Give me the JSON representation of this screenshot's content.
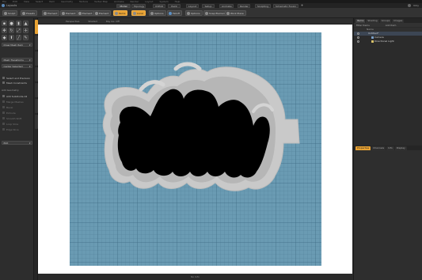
{
  "titlebar": {
    "items": [
      "File",
      "Edit",
      "View",
      "Select",
      "Item",
      "Geometry",
      "Texture",
      "Vertex Map",
      "Animate",
      "Render",
      "Layout",
      "System",
      "Help"
    ]
  },
  "app": {
    "title": "Layouts"
  },
  "layout_tabs": [
    "Model",
    "Topology",
    "UVEdit",
    "Paint",
    "Layout",
    "Setup",
    "Animate",
    "Render",
    "Sculpting",
    "Schematic Fusion"
  ],
  "layout_tabs_active": "Model",
  "tabbar_right": {
    "label": "Only"
  },
  "toolbar": {
    "buttons": [
      {
        "label": "Sculpt",
        "icon": "sculpt-icon"
      },
      {
        "label": "Presets",
        "icon": "presets-icon"
      },
      {
        "label": "Element",
        "icon": "vertex-icon"
      },
      {
        "label": "Element",
        "icon": "edge-icon"
      },
      {
        "label": "Element",
        "icon": "polygon-icon"
      },
      {
        "label": "Element",
        "icon": "item-icon"
      },
      {
        "label": "Items",
        "icon": "items-icon",
        "active": true
      },
      {
        "label": "Local",
        "icon": "local-icon",
        "active": true
      },
      {
        "label": "Options",
        "icon": "options-icon"
      },
      {
        "label": "Falloff",
        "icon": "falloff-icon"
      },
      {
        "label": "Options",
        "icon": "options-icon"
      },
      {
        "label": "Snap Element",
        "icon": "snap-icon"
      },
      {
        "label": "Work Plane",
        "icon": "workplane-icon"
      }
    ]
  },
  "leftpanel": {
    "dropdown_1": "Draw Mesh Item",
    "dropdown_2": "Mesh Transforms",
    "dropdown_3": "Center Selected",
    "items": [
      {
        "label": "Select and Precision",
        "dim": false
      },
      {
        "label": "Mesh Constraints",
        "dim": false
      }
    ],
    "section": "Add Geometry",
    "items2": [
      {
        "label": "Add Subdivide All",
        "dim": false
      },
      {
        "label": "Merge Meshes",
        "dim": true
      },
      {
        "label": "Bevel",
        "dim": true
      },
      {
        "label": "Extrude",
        "dim": true
      },
      {
        "label": "Smooth Shift",
        "dim": true
      },
      {
        "label": "Loop Slice",
        "dim": true
      },
      {
        "label": "Edge Slice",
        "dim": true
      }
    ],
    "dropdown_4": "Edit"
  },
  "viewport": {
    "header": [
      "Perspective",
      "Shaded",
      "Ray GL: Off"
    ],
    "footer": "No Info"
  },
  "rightpanel": {
    "tabs": [
      "Items",
      "Shading",
      "Groups",
      "Images"
    ],
    "active_tab": "Items",
    "header": [
      "Filter Items",
      "Add Item"
    ],
    "tree": [
      {
        "label": "Name",
        "indent": 0,
        "header": true
      },
      {
        "label": "Untitled*",
        "indent": 1
      },
      {
        "label": "Camera",
        "indent": 2
      },
      {
        "label": "Directional Light",
        "indent": 2
      }
    ],
    "bottom_tabs": [
      "Properties",
      "Channels",
      "Info",
      "Display"
    ]
  },
  "colors": {
    "accent": "#e8a233",
    "grid": "#5f8fa8",
    "grid_line": "#4a7a94",
    "plate": "#8ea3ad",
    "cutter": "#cfcfcf",
    "shape": "#000000"
  }
}
